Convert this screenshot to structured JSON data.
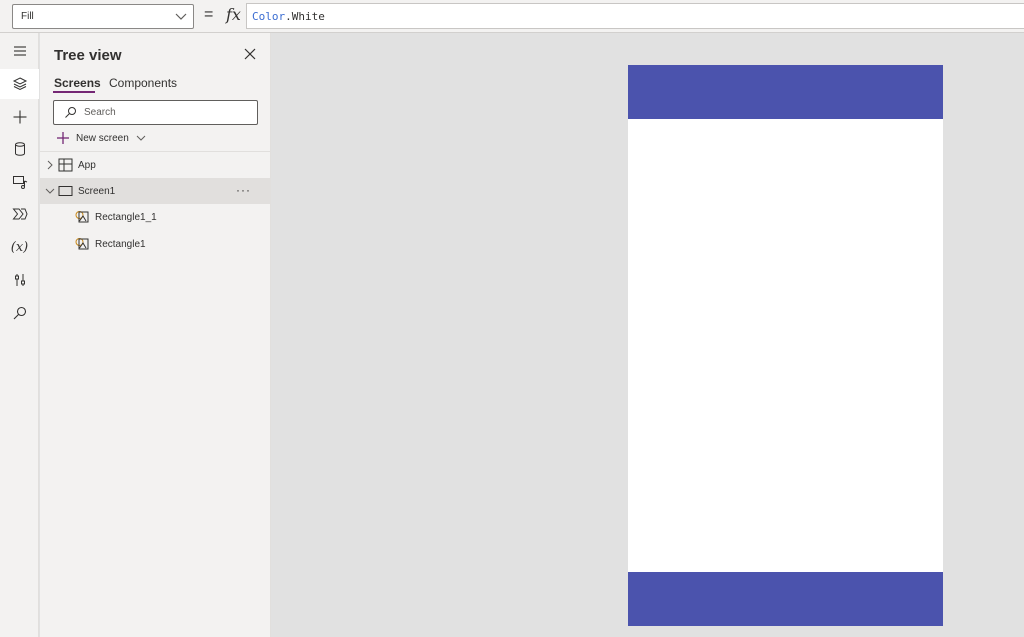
{
  "formula_bar": {
    "property": "Fill",
    "equals": "=",
    "fx": "fx",
    "formula_keyword": "Color",
    "formula_dot": ".",
    "formula_member": "White"
  },
  "rail": {
    "items": [
      "hamburger-icon",
      "layers-icon",
      "plus-icon",
      "database-icon",
      "media-icon",
      "power-automate-icon",
      "variables-icon",
      "settings-icon",
      "search-icon"
    ],
    "variables_glyph": "(x)"
  },
  "tree_view": {
    "title": "Tree view",
    "tabs": [
      {
        "label": "Screens",
        "active": true
      },
      {
        "label": "Components",
        "active": false
      }
    ],
    "search_placeholder": "Search",
    "new_screen_label": "New screen",
    "nodes": [
      {
        "label": "App",
        "type": "app",
        "expanded": false
      },
      {
        "label": "Screen1",
        "type": "screen",
        "expanded": true,
        "selected": true,
        "more": "···"
      },
      {
        "label": "Rectangle1_1",
        "type": "rectangle"
      },
      {
        "label": "Rectangle1",
        "type": "rectangle"
      }
    ]
  },
  "colors": {
    "accent": "#742774",
    "rectangle_fill": "#4b53ad",
    "screen_fill": "#ffffff",
    "canvas_bg": "#e1e1e1"
  }
}
